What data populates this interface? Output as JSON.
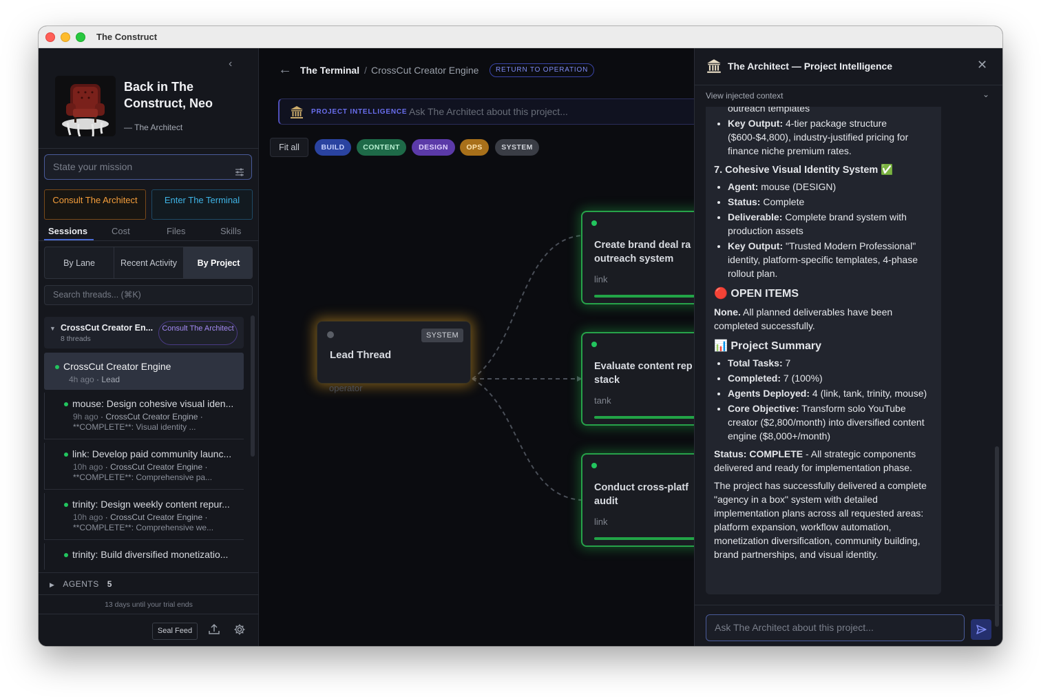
{
  "window": {
    "title": "The Construct"
  },
  "sidebar": {
    "greeting": "Back in The Construct, Neo",
    "signature": "— The Architect",
    "mission_placeholder": "State your mission",
    "consult_button": "Consult The Architect",
    "enter_button": "Enter The Terminal",
    "tabs": [
      "Sessions",
      "Cost",
      "Files",
      "Skills"
    ],
    "active_tab": "Sessions",
    "views": [
      "By Lane",
      "Recent Activity",
      "By Project"
    ],
    "active_view": "By Project",
    "search_placeholder": "Search threads... (⌘K)",
    "group": {
      "name": "CrossCut Creator En...",
      "count": "8 threads",
      "button": "Consult The Architect"
    },
    "active_thread": {
      "title": "CrossCut Creator Engine",
      "time": "4h ago",
      "role": "Lead"
    },
    "threads": [
      {
        "title": "mouse: Design cohesive visual iden...",
        "time": "9h ago",
        "project": "CrossCut Creator Engine",
        "summary": "**COMPLETE**: Visual identity ..."
      },
      {
        "title": "link: Develop paid community launc...",
        "time": "10h ago",
        "project": "CrossCut Creator Engine",
        "summary": "**COMPLETE**: Comprehensive pa..."
      },
      {
        "title": "trinity: Design weekly content repur...",
        "time": "10h ago",
        "project": "CrossCut Creator Engine",
        "summary": "**COMPLETE**: Comprehensive we..."
      },
      {
        "title": "trinity: Build diversified monetizatio...",
        "time": "",
        "project": "",
        "summary": ""
      }
    ],
    "agents_label": "AGENTS",
    "agents_count": "5",
    "trial_text": "13 days until your trial ends",
    "seal_feed": "Seal Feed"
  },
  "main": {
    "crumb_root": "The Terminal",
    "crumb_sep": "/",
    "crumb_current": "CrossCut Creator Engine",
    "return_button": "RETURN TO OPERATION",
    "pi_label": "PROJECT INTELLIGENCE",
    "pi_placeholder": "Ask The Architect about this project...",
    "fit_all": "Fit all",
    "filters": [
      "BUILD",
      "CONTENT",
      "DESIGN",
      "OPS",
      "SYSTEM"
    ],
    "lead_node": {
      "title": "Lead Thread",
      "badge": "SYSTEM",
      "agent": "operator"
    },
    "nodes": [
      {
        "line1": "Create brand deal ra",
        "line2": "outreach system",
        "agent": "link"
      },
      {
        "line1": "Evaluate content rep",
        "line2": "stack",
        "agent": "tank"
      },
      {
        "line1": "Conduct cross-platf",
        "line2": "audit",
        "agent": "link"
      }
    ]
  },
  "panel": {
    "title": "The Architect — Project Intelligence",
    "context_label": "View injected context",
    "input_placeholder": "Ask The Architect about this project...",
    "message": {
      "cont_line": "outreach templates",
      "key_output_1_label": "Key Output:",
      "key_output_1": " 4-tier package structure ($600-$4,800), industry-justified pricing for finance niche premium rates.",
      "section7": "7. Cohesive Visual Identity System ✅",
      "agent_label": "Agent:",
      "agent": " mouse (DESIGN)",
      "status_label": "Status:",
      "status": " Complete",
      "deliverable_label": "Deliverable:",
      "deliverable": " Complete brand system with production assets",
      "key_output_2_label": "Key Output:",
      "key_output_2": " \"Trusted Modern Professional\" identity, platform-specific templates, 4-phase rollout plan.",
      "open_items_heading": "🔴 OPEN ITEMS",
      "open_items_bold": "None.",
      "open_items_text": " All planned deliverables have been completed successfully.",
      "summary_heading": "📊 Project Summary",
      "total_label": "Total Tasks:",
      "total": " 7",
      "completed_label": "Completed:",
      "completed": " 7 (100%)",
      "deployed_label": "Agents Deployed:",
      "deployed": " 4 (link, tank, trinity, mouse)",
      "objective_label": "Core Objective:",
      "objective": " Transform solo YouTube creator ($2,800/month) into diversified content engine ($8,000+/month)",
      "final_status_label": "Status: COMPLETE",
      "final_status": " - All strategic components delivered and ready for implementation phase.",
      "closing": "The project has successfully delivered a complete \"agency in a box\" system with detailed implementation plans across all requested areas: platform expansion, workflow automation, monetization diversification, community building, brand partnerships, and visual identity."
    }
  },
  "colors": {
    "accent": "#4a6cd4",
    "success": "#22c55e",
    "lead_glow": "#fab428",
    "consult": "#f59e3b",
    "terminal": "#3fb4e6"
  }
}
